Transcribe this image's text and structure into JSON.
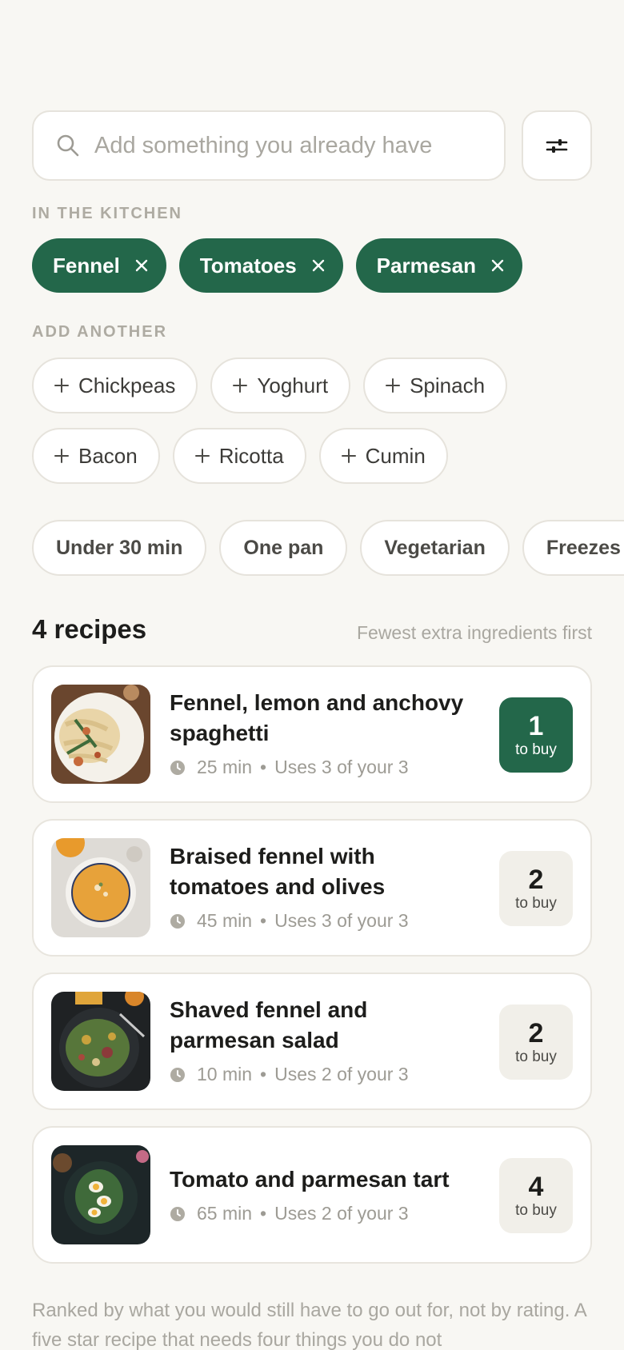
{
  "search": {
    "placeholder": "Add something you already have",
    "icon": "search-icon",
    "filter_icon": "sliders-icon"
  },
  "kitchen": {
    "label": "IN THE KITCHEN",
    "items": [
      {
        "label": "Fennel"
      },
      {
        "label": "Tomatoes"
      },
      {
        "label": "Parmesan"
      }
    ]
  },
  "add_another": {
    "label": "ADD ANOTHER",
    "row1": [
      {
        "label": "Chickpeas"
      },
      {
        "label": "Yoghurt"
      },
      {
        "label": "Spinach"
      }
    ],
    "row2": [
      {
        "label": "Bacon"
      },
      {
        "label": "Ricotta"
      },
      {
        "label": "Cumin"
      }
    ]
  },
  "filters": [
    {
      "label": "Under 30 min"
    },
    {
      "label": "One pan"
    },
    {
      "label": "Vegetarian"
    },
    {
      "label": "Freezes well"
    }
  ],
  "results": {
    "count": "4 recipes",
    "sort": "Fewest extra ingredients first"
  },
  "recipes": [
    {
      "title": "Fennel, lemon and anchovy spaghetti",
      "time": "25 min",
      "uses": "Uses 3 of your 3",
      "to_buy": "1",
      "to_buy_label": "to buy"
    },
    {
      "title": "Braised fennel with tomatoes and olives",
      "time": "45 min",
      "uses": "Uses 3 of your 3",
      "to_buy": "2",
      "to_buy_label": "to buy"
    },
    {
      "title": "Shaved fennel and parmesan salad",
      "time": "10 min",
      "uses": "Uses 2 of your 3",
      "to_buy": "2",
      "to_buy_label": "to buy"
    },
    {
      "title": "Tomato and parmesan tart",
      "time": "65 min",
      "uses": "Uses 2 of your 3",
      "to_buy": "4",
      "to_buy_label": "to buy"
    }
  ],
  "footnote": "Ranked by what you would still have to go out for, not by rating. A five star recipe that needs four things you do not",
  "colors": {
    "accent": "#23674a",
    "background": "#f8f7f3",
    "muted": "#a9a7a0"
  }
}
